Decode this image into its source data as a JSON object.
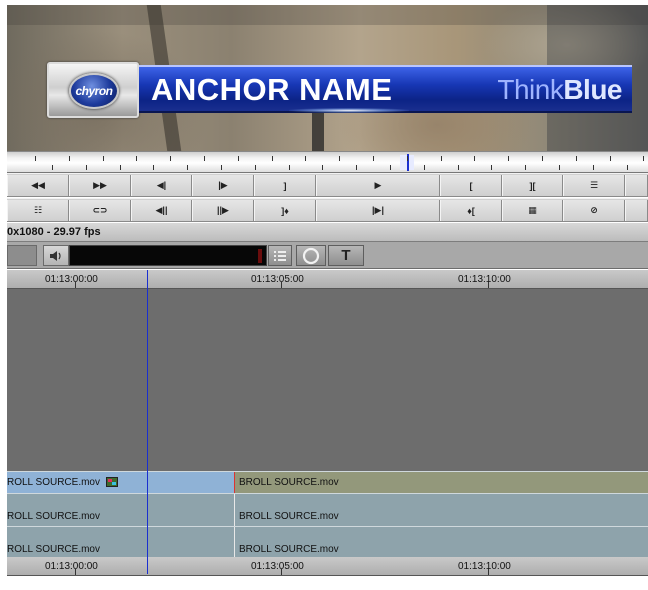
{
  "monitor": {
    "logo_text": "chyron",
    "anchor_name": "ANCHOR NAME",
    "brand_light": "Think",
    "brand_bold": "Blue"
  },
  "transport": {
    "row1": [
      {
        "icon": "rewind-icon",
        "glyph": "◀◀"
      },
      {
        "icon": "fast-forward-icon",
        "glyph": "▶▶"
      },
      {
        "icon": "step-back-icon",
        "glyph": "◀|"
      },
      {
        "icon": "step-forward-icon",
        "glyph": "|▶"
      },
      {
        "icon": "mark-out-icon",
        "glyph": "]"
      },
      {
        "icon": "play-icon",
        "glyph": "▶"
      },
      {
        "icon": "mark-in-icon",
        "glyph": "["
      },
      {
        "icon": "mark-clip-icon",
        "glyph": "]["
      },
      {
        "icon": "clear-marks-icon",
        "glyph": "☰"
      }
    ],
    "row2": [
      {
        "icon": "list-icon",
        "glyph": "☷"
      },
      {
        "icon": "link-icon",
        "glyph": "⊂⊃"
      },
      {
        "icon": "step-back-frames-icon",
        "glyph": "◀||"
      },
      {
        "icon": "step-forward-frames-icon",
        "glyph": "||▶"
      },
      {
        "icon": "go-to-out-icon",
        "glyph": "]♦"
      },
      {
        "icon": "play-in-out-icon",
        "glyph": "|▶|"
      },
      {
        "icon": "go-to-in-icon",
        "glyph": "♦["
      },
      {
        "icon": "match-frame-icon",
        "glyph": "▦"
      },
      {
        "icon": "no-entry-icon",
        "glyph": "⊘"
      }
    ]
  },
  "format": {
    "text": "0x1080 - 29.97 fps"
  },
  "timeline_controls": {
    "speaker_icon": "speaker-icon",
    "list_icon": "list-icon",
    "record_icon": "record-icon",
    "text_icon": "text-tool-icon",
    "text_glyph": "T"
  },
  "ruler": {
    "labels": [
      "01:13:00:00",
      "01:13:05:00",
      "01:13:10:00"
    ]
  },
  "tracks": {
    "video": [
      {
        "label": "ROLL SOURCE.mov"
      },
      {
        "label": "BROLL SOURCE.mov"
      }
    ],
    "audio1": [
      {
        "label": "ROLL SOURCE.mov"
      },
      {
        "label": "BROLL SOURCE.mov"
      }
    ],
    "audio2": [
      {
        "label": "ROLL SOURCE.mov"
      },
      {
        "label": "BROLL SOURCE.mov"
      }
    ]
  },
  "colors": {
    "playhead": "#1a2fd0",
    "video_clip_selected": "#8fb2d6",
    "video_clip": "#93987b",
    "audio_clip": "#8ea3ab",
    "track_bg": "#6d6d6d"
  }
}
